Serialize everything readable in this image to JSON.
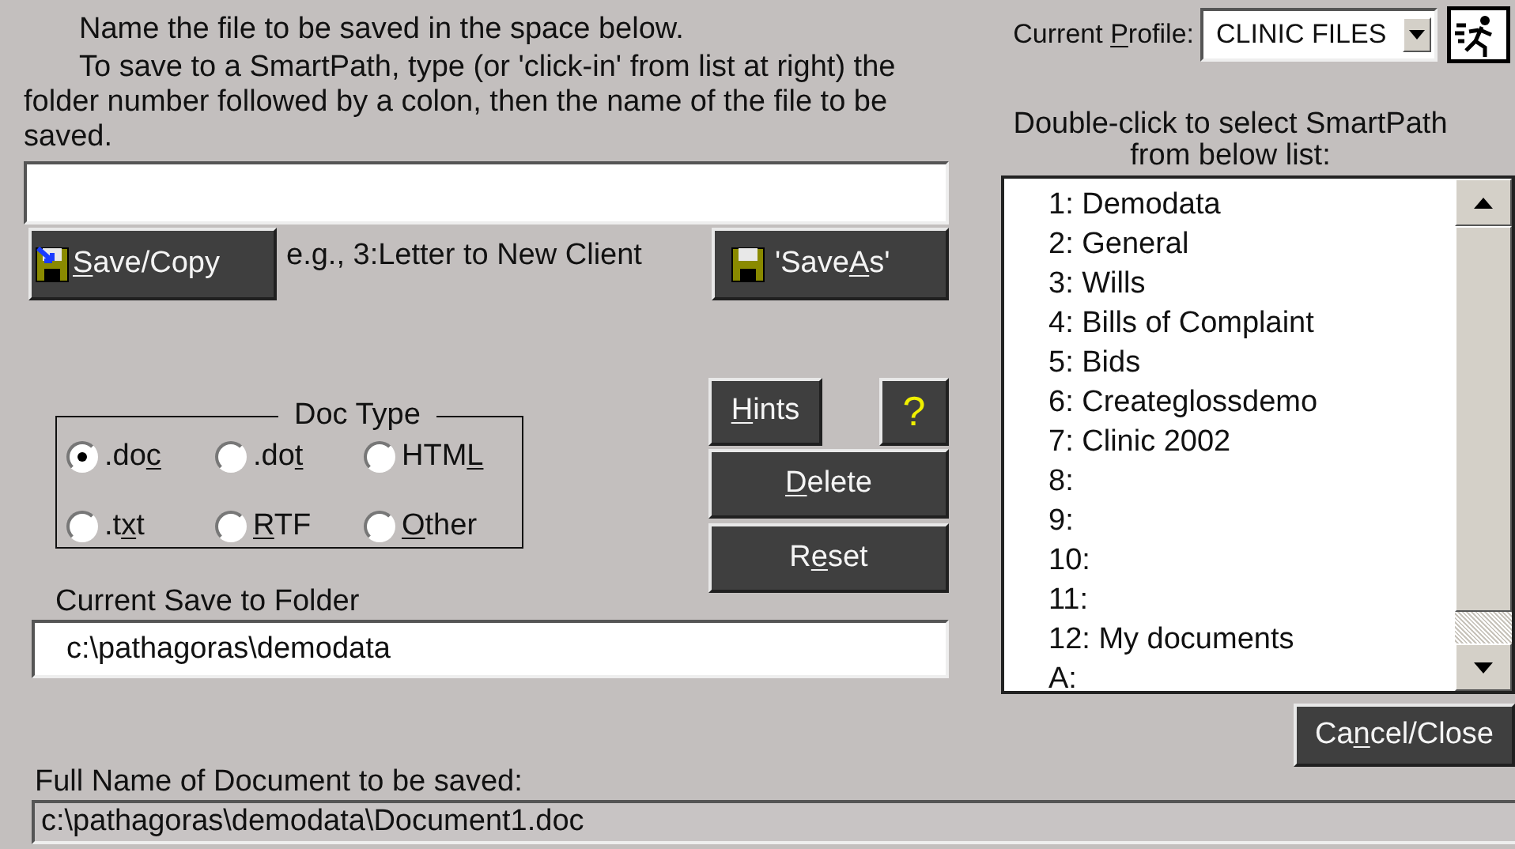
{
  "instructions": [
    "Name the file to be saved in the space below.",
    "To save to a SmartPath, type (or 'click-in' from list at right) the folder number followed by a colon, then the name of the file to be saved."
  ],
  "save_copy_button": {
    "hotkey": "S",
    "after": "ave/Copy"
  },
  "example_hint": "e.g., 3:Letter to New Client",
  "save_as_button": {
    "before": "'Save",
    "hotkey": "A",
    "after": "s'"
  },
  "doc_type": {
    "title": "Doc Type",
    "options": [
      {
        "before": ".do",
        "hotkey": "c",
        "selected": true
      },
      {
        "before": ".do",
        "hotkey": "t",
        "selected": false
      },
      {
        "before": "HTM",
        "hotkey": "L",
        "selected": false
      },
      {
        "before": ".t",
        "hotkey": "x",
        "after": "t",
        "selected": false
      },
      {
        "hotkey": "R",
        "after": "TF",
        "selected": false
      },
      {
        "hotkey": "O",
        "after": "ther",
        "selected": false
      }
    ]
  },
  "hints_button": {
    "hotkey": "H",
    "after": "ints"
  },
  "help_button": {
    "label": "?"
  },
  "delete_button": {
    "hotkey": "D",
    "after": "elete"
  },
  "reset_button": {
    "before": "R",
    "hotkey": "e",
    "after": "set"
  },
  "current_folder": {
    "label": "Current Save to Folder",
    "value": "c:\\pathagoras\\demodata"
  },
  "profile": {
    "before": "Current ",
    "hotkey": "P",
    "after": "rofile:",
    "value": "CLINIC FILES"
  },
  "smartpath_caption": "Double-click to select SmartPath from below list:",
  "smartpaths": [
    {
      "label": "1: Demodata"
    },
    {
      "label": "2: General"
    },
    {
      "label": "3: Wills"
    },
    {
      "label": "4: Bills of Complaint"
    },
    {
      "label": "5: Bids"
    },
    {
      "label": "6: Createglossdemo"
    },
    {
      "label": "7: Clinic 2002"
    },
    {
      "label": "8:"
    },
    {
      "label": "9:"
    },
    {
      "label": "10:"
    },
    {
      "label": "11:"
    },
    {
      "label": "12: My documents"
    },
    {
      "label": "A:"
    }
  ],
  "cancel_button": {
    "before": "Ca",
    "hotkey": "n",
    "after": "cel/Close"
  },
  "full_name": {
    "label": "Full Name of Document to be saved:",
    "value": "c:\\pathagoras\\demodata\\Document1.doc"
  }
}
